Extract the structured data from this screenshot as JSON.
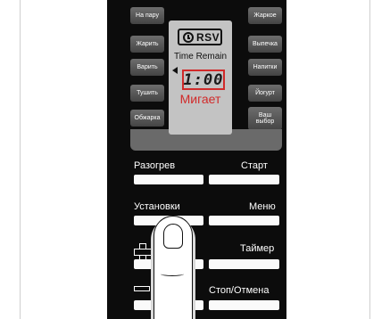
{
  "side_left": [
    {
      "label": "На пару"
    },
    {
      "label": "Жарить"
    },
    {
      "label": "Варить"
    },
    {
      "label": "Тушить"
    },
    {
      "label": "Обжарка"
    }
  ],
  "side_right": [
    {
      "label": "Жаркое"
    },
    {
      "label": "Выпечка"
    },
    {
      "label": "Напитки"
    },
    {
      "label": "Йогурт"
    },
    {
      "label": "Ваш выбор"
    }
  ],
  "display": {
    "rsv_label": "RSV",
    "time_remain": "Time Remain",
    "digits": "1:00",
    "blink_label": "Мигает",
    "icons": {
      "clock": "clock-icon",
      "arrow": "arrow-left-icon"
    }
  },
  "controls": {
    "reheat": "Разогрев",
    "start": "Старт",
    "settings": "Установки",
    "menu": "Меню",
    "timer": "Таймер",
    "stop_cancel": "Стоп/Отмена",
    "plus_icon": "plus-icon",
    "minus_icon": "minus-icon"
  },
  "colors": {
    "panel": "#0c0c0c",
    "lcd": "#c3c3c3",
    "highlight": "#d12a2a"
  }
}
